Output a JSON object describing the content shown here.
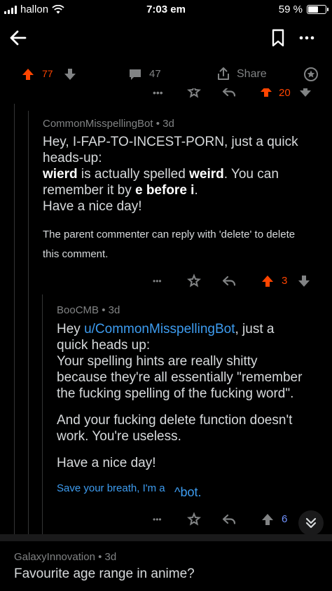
{
  "status": {
    "carrier": "hallon",
    "time": "7:03 em",
    "battery_text": "59 %",
    "battery_level": 0.59
  },
  "post_actions": {
    "upvotes": "77",
    "comments": "47",
    "share": "Share"
  },
  "peek_row": {
    "dots": "•••",
    "count": "20"
  },
  "comments": [
    {
      "author": "CommonMisspellingBot",
      "age": "3d",
      "body_line1": "Hey, I-FAP-TO-INCEST-PORN, just a quick",
      "body_line2": "heads-up:",
      "body_wrong": "wierd",
      "body_mid": " is actually spelled ",
      "body_right": "weird",
      "body_tail": ". You can",
      "body_line4a": "remember it by ",
      "body_rule": "e before i",
      "body_line4b": ".",
      "body_line5": "Have a nice day!",
      "footer_line1": "The parent commenter can reply with 'delete' to delete",
      "footer_line2": "this comment.",
      "actions": {
        "dots": "•••",
        "score": "3"
      }
    },
    {
      "author": "BooCMB",
      "age": "3d",
      "greeting": "Hey ",
      "mention": "u/CommonMisspellingBot",
      "greeting_tail": ", just a",
      "line2": "quick heads up:",
      "line3": "Your spelling hints are really shitty",
      "line4": "because they're all essentially \"remember",
      "line5": "the fucking spelling of the fucking word\".",
      "para2_line1": "And your fucking delete function doesn't",
      "para2_line2": "work. You're useless.",
      "para3": "Have a nice day!",
      "footer_link": "Save your breath, I'm a",
      "footer_sup": "^bot.",
      "actions": {
        "dots": "•••",
        "score": "6"
      }
    }
  ],
  "bottom_comment": {
    "author": "GalaxyInnovation",
    "age": "3d",
    "body": "Favourite age range in anime?"
  },
  "colors": {
    "background": "#000000",
    "upvote": "#ff4500",
    "link": "#3d9cf0",
    "upvote_blue": "#7193ff",
    "muted": "#818384"
  }
}
